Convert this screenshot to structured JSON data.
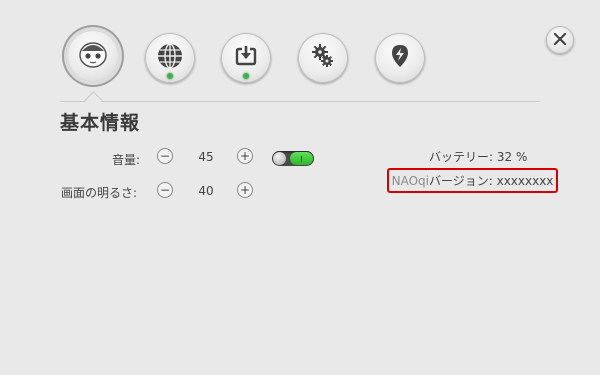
{
  "nav": {
    "items": [
      {
        "icon": "robot-face-icon",
        "active": true,
        "dot": false
      },
      {
        "icon": "globe-icon",
        "active": false,
        "dot": true
      },
      {
        "icon": "download-icon",
        "active": false,
        "dot": true
      },
      {
        "icon": "gears-icon",
        "active": false,
        "dot": false
      },
      {
        "icon": "location-bolt-icon",
        "active": false,
        "dot": false
      }
    ],
    "close_icon": "close-icon",
    "dot_color": "#3bb54a"
  },
  "section": {
    "title": "基本情報"
  },
  "volume": {
    "label": "音量:",
    "minus": "−",
    "plus": "+",
    "value": "45",
    "toggle_on": true
  },
  "brightness": {
    "label": "画面の明るさ:",
    "minus": "−",
    "plus": "+",
    "value": "40"
  },
  "info": {
    "battery": "バッテリー: 32 %",
    "version_prefix": "NAOqi",
    "version_label": "バージョン: xxxxxxxx",
    "highlight_color": "#d40000"
  }
}
